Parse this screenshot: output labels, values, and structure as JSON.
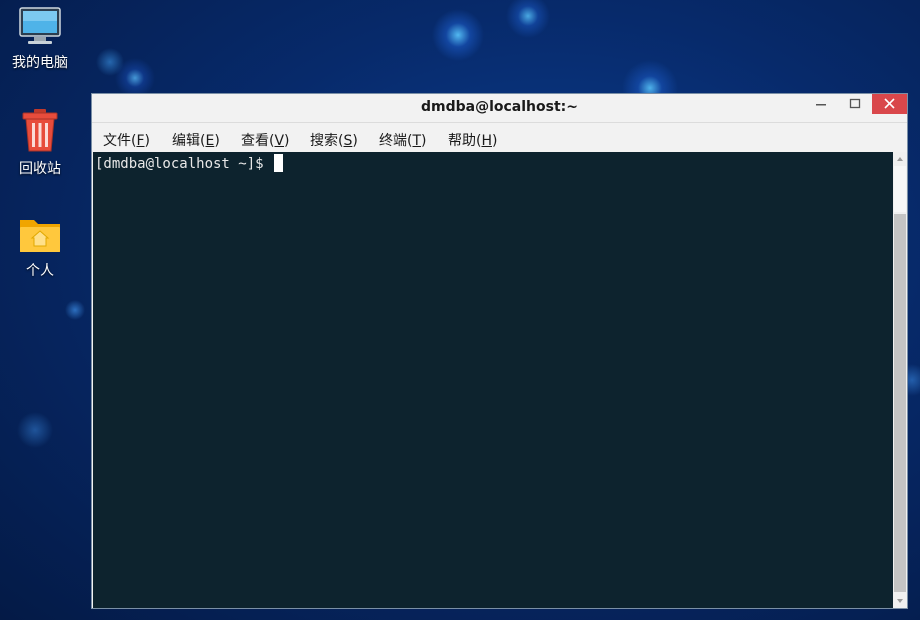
{
  "desktop": {
    "icons": [
      {
        "label": "我的电脑",
        "icon": "computer-monitor-icon"
      },
      {
        "label": "回收站",
        "icon": "trash-bin-icon"
      },
      {
        "label": "个人",
        "icon": "home-folder-icon"
      }
    ]
  },
  "window": {
    "title": "dmdba@localhost:~",
    "buttons": {
      "minimize": "minimize-icon",
      "maximize": "maximize-icon",
      "close": "close-icon"
    },
    "close_color": "#d9474b",
    "menu": [
      {
        "label": "文件",
        "mnemonic": "F"
      },
      {
        "label": "编辑",
        "mnemonic": "E"
      },
      {
        "label": "查看",
        "mnemonic": "V"
      },
      {
        "label": "搜索",
        "mnemonic": "S"
      },
      {
        "label": "终端",
        "mnemonic": "T"
      },
      {
        "label": "帮助",
        "mnemonic": "H"
      }
    ]
  },
  "terminal": {
    "prompt": "[dmdba@localhost ~]$",
    "background": "#0d232e",
    "foreground": "#e8e8e8"
  }
}
